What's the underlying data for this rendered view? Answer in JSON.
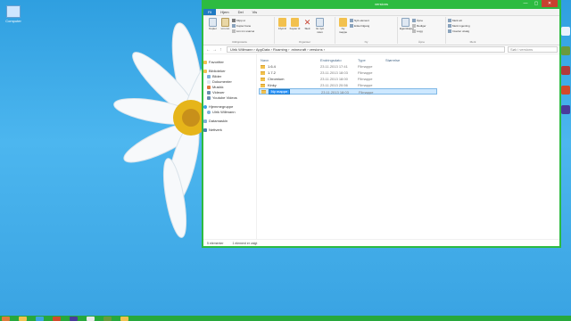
{
  "desktop": {
    "icon_label": "Computer"
  },
  "window": {
    "title": "versions",
    "controls": {
      "minimize": "—",
      "maximize": "▢",
      "close": "✕"
    }
  },
  "ribbon": {
    "tabs": [
      "Fil",
      "Hjem",
      "Del",
      "Vis"
    ],
    "groups": {
      "clipboard": {
        "label": "Utklippstavle",
        "copy": "Kopier",
        "paste": "Lim inn",
        "cut": "Klipp ut",
        "copy_path": "Kopier bane",
        "paste_shortcut": "Lim inn snarvei"
      },
      "organize": {
        "label": "Organiser",
        "move_to": "Flytt til",
        "copy_to": "Kopier til",
        "delete": "Slett",
        "rename": "Gi nytt navn"
      },
      "new": {
        "label": "Ny",
        "new_item": "Nytt element",
        "easy_access": "Enkel tilgang",
        "new_folder": "Ny mappe"
      },
      "open": {
        "label": "Åpne",
        "properties": "Egenskaper",
        "open": "Åpne",
        "edit": "Rediger",
        "history": "Logg"
      },
      "select": {
        "label": "Merk",
        "select_all": "Merk alt",
        "select_none": "Merk ingenting",
        "invert": "Inverter utvalg"
      }
    }
  },
  "address": {
    "path": "Ulrik Willmann › AppData › Roaming › .minecraft › versions ›",
    "search_placeholder": "Søk i versions"
  },
  "navpane": {
    "favorites": "Favoritter",
    "libraries": "Biblioteker",
    "library_items": [
      "Bilder",
      "Dokumenter",
      "Musikk",
      "Videoer",
      "Youtube Videos"
    ],
    "homegroup": "Hjemmegruppe",
    "homegroup_user": "Ulrik Willmann",
    "computer": "Datamaskin",
    "network": "Nettverk"
  },
  "files": {
    "columns": [
      "Navn",
      "Endringsdato",
      "Type",
      "Størrelse"
    ],
    "rows": [
      {
        "name": "1.6.4",
        "date": "23.11.2013 17:41",
        "type": "Filmappe"
      },
      {
        "name": "1.7.2",
        "date": "23.11.2013 18:03",
        "type": "Filmappe"
      },
      {
        "name": "Chromium",
        "date": "23.11.2013 18:00",
        "type": "Filmappe"
      },
      {
        "name": "Kinky",
        "date": "23.11.2013 20:56",
        "type": "Filmappe"
      },
      {
        "name": "Ny mappe",
        "date": "23.11.2013 18:03",
        "type": "Filmappe"
      }
    ]
  },
  "status": {
    "count": "5 elementer",
    "selected": "1 element er valgt"
  }
}
